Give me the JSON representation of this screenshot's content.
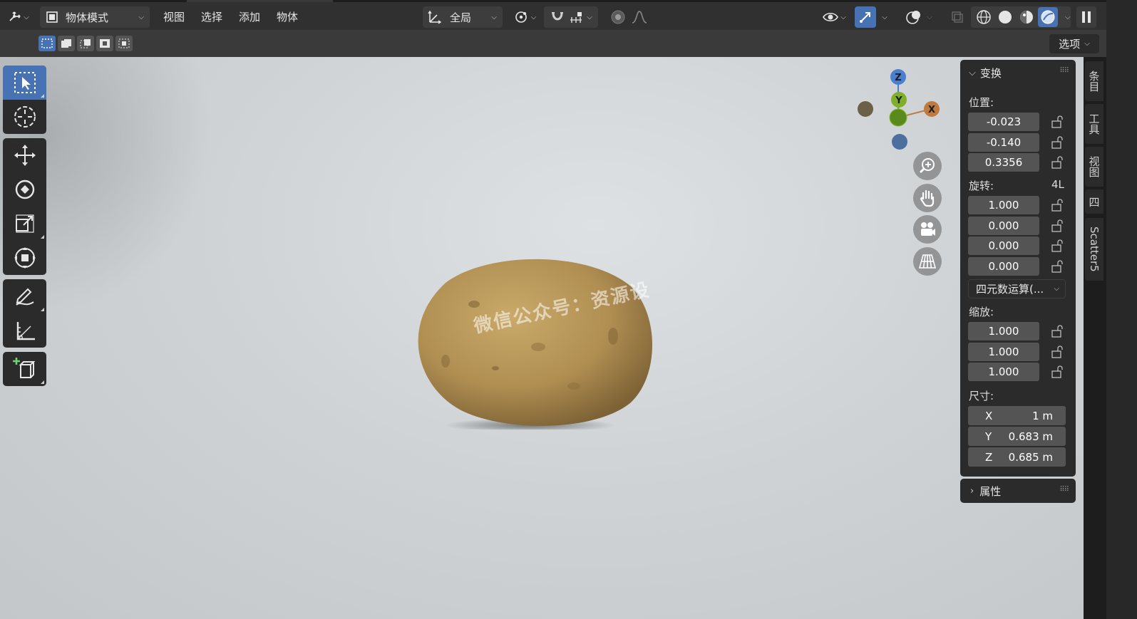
{
  "header": {
    "mode_label": "物体模式",
    "menus": [
      "视图",
      "选择",
      "添加",
      "物体"
    ],
    "orientation_label": "全局"
  },
  "toolsettings": {
    "options_label": "选项"
  },
  "viewport": {
    "watermark": "微信公众号：资源设"
  },
  "gizmo": {
    "axis_x": "X",
    "axis_y": "Y",
    "axis_z": "Z"
  },
  "npanel": {
    "title": "变换",
    "location_label": "位置:",
    "location": [
      "-0.023",
      "-0.140",
      "0.3356"
    ],
    "rotation_label": "旋转:",
    "rotation_mode_badge": "4L",
    "rotation": [
      "1.000",
      "0.000",
      "0.000",
      "0.000"
    ],
    "rotation_mode_dropdown": "四元数运算(...",
    "scale_label": "缩放:",
    "scale": [
      "1.000",
      "1.000",
      "1.000"
    ],
    "dimensions_label": "尺寸:",
    "dimensions": [
      {
        "axis": "X",
        "value": "1 m"
      },
      {
        "axis": "Y",
        "value": "0.683 m"
      },
      {
        "axis": "Z",
        "value": "0.685 m"
      }
    ],
    "properties_title": "属性"
  },
  "tabs": [
    "条目",
    "工具",
    "视图",
    "四",
    "Scatter5"
  ],
  "colors": {
    "accent": "#4772b3",
    "panel": "#2b2b2b",
    "field": "#545454",
    "header": "#303030"
  }
}
